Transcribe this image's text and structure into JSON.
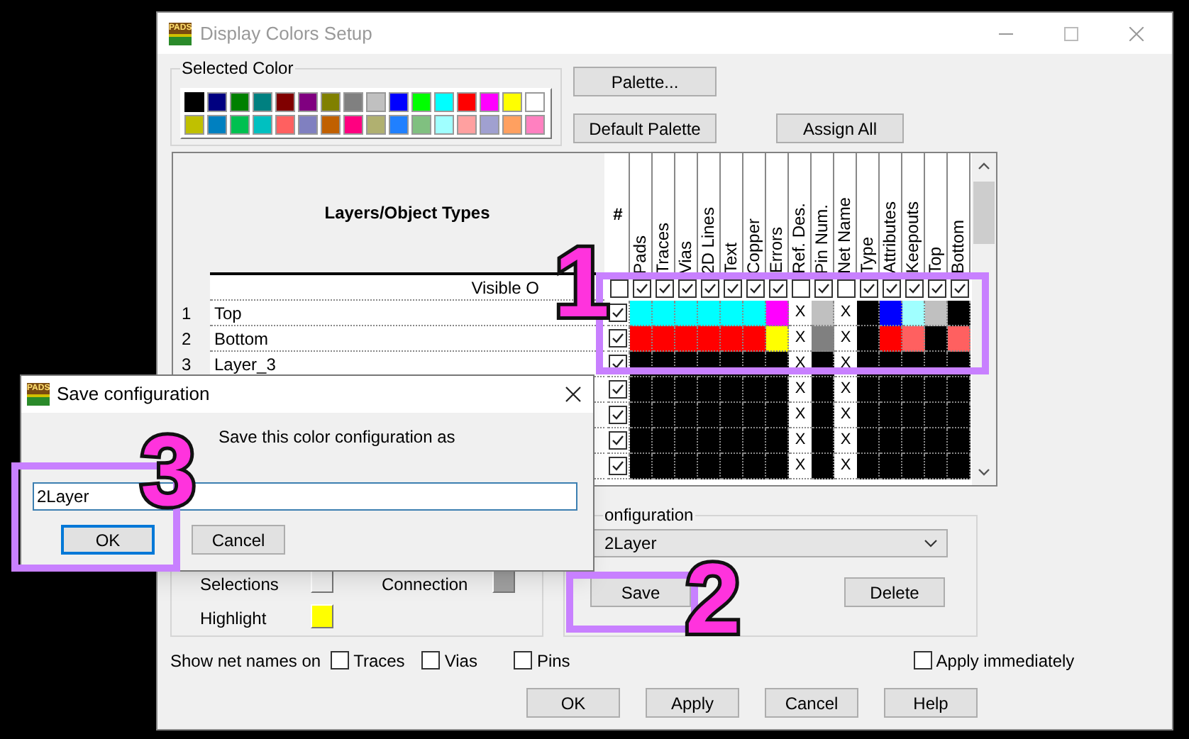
{
  "main_window": {
    "icon_label": "PADS",
    "title": "Display Colors Setup"
  },
  "selected_color": {
    "label": "Selected Color",
    "swatches": [
      {
        "color": "#000000",
        "selected": true
      },
      {
        "color": "#000080",
        "selected": false
      },
      {
        "color": "#008000",
        "selected": false
      },
      {
        "color": "#008080",
        "selected": false
      },
      {
        "color": "#800000",
        "selected": false
      },
      {
        "color": "#800080",
        "selected": false
      },
      {
        "color": "#808000",
        "selected": false
      },
      {
        "color": "#808080",
        "selected": false
      },
      {
        "color": "#c0c0c0",
        "selected": false
      },
      {
        "color": "#0000ff",
        "selected": false
      },
      {
        "color": "#00ff00",
        "selected": false
      },
      {
        "color": "#00ffff",
        "selected": false
      },
      {
        "color": "#ff0000",
        "selected": false
      },
      {
        "color": "#ff00ff",
        "selected": false
      },
      {
        "color": "#ffff00",
        "selected": false
      },
      {
        "color": "#ffffff",
        "selected": false
      },
      {
        "color": "#c0c000",
        "selected": false
      },
      {
        "color": "#0080c0",
        "selected": false
      },
      {
        "color": "#00c050",
        "selected": false
      },
      {
        "color": "#00c0c0",
        "selected": false
      },
      {
        "color": "#ff6060",
        "selected": false
      },
      {
        "color": "#8080c0",
        "selected": false
      },
      {
        "color": "#c06000",
        "selected": false
      },
      {
        "color": "#ff0080",
        "selected": false
      },
      {
        "color": "#b0b070",
        "selected": false
      },
      {
        "color": "#2080ff",
        "selected": false
      },
      {
        "color": "#80c080",
        "selected": false
      },
      {
        "color": "#a0ffff",
        "selected": false
      },
      {
        "color": "#ffa0a0",
        "selected": false
      },
      {
        "color": "#a0a0d0",
        "selected": false
      },
      {
        "color": "#ffa060",
        "selected": false
      },
      {
        "color": "#ff80c0",
        "selected": false
      }
    ]
  },
  "palette_buttons": [
    "Palette...",
    "Default Palette",
    "Assign All"
  ],
  "grid": {
    "title": "Layers/Object Types",
    "visible_label": "Visible O",
    "hash_header": "#",
    "hash_visible": false,
    "columns": [
      {
        "label": "Pads",
        "visible": true
      },
      {
        "label": "Traces",
        "visible": true
      },
      {
        "label": "Vias",
        "visible": true
      },
      {
        "label": "2D Lines",
        "visible": true
      },
      {
        "label": "Text",
        "visible": true
      },
      {
        "label": "Copper",
        "visible": true
      },
      {
        "label": "Errors",
        "visible": true
      },
      {
        "label": "Ref. Des.",
        "visible": false
      },
      {
        "label": "Pin Num.",
        "visible": true
      },
      {
        "label": "Net Name",
        "visible": false
      },
      {
        "label": "Type",
        "visible": true
      },
      {
        "label": "Attributes",
        "visible": true
      },
      {
        "label": "Keepouts",
        "visible": true
      },
      {
        "label": "Top",
        "visible": true
      },
      {
        "label": "Bottom",
        "visible": true
      }
    ],
    "rows": [
      {
        "number": "1",
        "name": "Top",
        "shown": true,
        "cells": [
          {
            "kind": "color",
            "color": "#00ffff"
          },
          {
            "kind": "color",
            "color": "#00ffff"
          },
          {
            "kind": "color",
            "color": "#00ffff"
          },
          {
            "kind": "color",
            "color": "#00ffff"
          },
          {
            "kind": "color",
            "color": "#00ffff"
          },
          {
            "kind": "color",
            "color": "#00ffff"
          },
          {
            "kind": "color",
            "color": "#ff00ff"
          },
          {
            "kind": "mark",
            "text": "X"
          },
          {
            "kind": "color",
            "color": "#c0c0c0"
          },
          {
            "kind": "mark",
            "text": "X"
          },
          {
            "kind": "color",
            "color": "#000000"
          },
          {
            "kind": "color",
            "color": "#0000ff"
          },
          {
            "kind": "color",
            "color": "#a0ffff"
          },
          {
            "kind": "color",
            "color": "#c0c0c0"
          },
          {
            "kind": "color",
            "color": "#000000"
          }
        ]
      },
      {
        "number": "2",
        "name": "Bottom",
        "shown": true,
        "cells": [
          {
            "kind": "color",
            "color": "#ff0000"
          },
          {
            "kind": "color",
            "color": "#ff0000"
          },
          {
            "kind": "color",
            "color": "#ff0000"
          },
          {
            "kind": "color",
            "color": "#ff0000"
          },
          {
            "kind": "color",
            "color": "#ff0000"
          },
          {
            "kind": "color",
            "color": "#ff0000"
          },
          {
            "kind": "color",
            "color": "#ffff00"
          },
          {
            "kind": "mark",
            "text": "X"
          },
          {
            "kind": "color",
            "color": "#808080"
          },
          {
            "kind": "mark",
            "text": "X"
          },
          {
            "kind": "color",
            "color": "#000000"
          },
          {
            "kind": "color",
            "color": "#ff0000"
          },
          {
            "kind": "color",
            "color": "#ff6060"
          },
          {
            "kind": "color",
            "color": "#000000"
          },
          {
            "kind": "color",
            "color": "#ff6060"
          }
        ]
      },
      {
        "number": "3",
        "name": "Layer_3",
        "shown": true,
        "cells": [
          {
            "kind": "color",
            "color": "#000000"
          },
          {
            "kind": "color",
            "color": "#000000"
          },
          {
            "kind": "color",
            "color": "#000000"
          },
          {
            "kind": "color",
            "color": "#000000"
          },
          {
            "kind": "color",
            "color": "#000000"
          },
          {
            "kind": "color",
            "color": "#000000"
          },
          {
            "kind": "color",
            "color": "#000000"
          },
          {
            "kind": "mark",
            "text": "X"
          },
          {
            "kind": "color",
            "color": "#000000"
          },
          {
            "kind": "mark",
            "text": "X"
          },
          {
            "kind": "color",
            "color": "#000000"
          },
          {
            "kind": "color",
            "color": "#000000"
          },
          {
            "kind": "color",
            "color": "#000000"
          },
          {
            "kind": "color",
            "color": "#000000"
          },
          {
            "kind": "color",
            "color": "#000000"
          }
        ]
      },
      {
        "shown": true,
        "cells": [
          {
            "kind": "color",
            "color": "#000000"
          },
          {
            "kind": "color",
            "color": "#000000"
          },
          {
            "kind": "color",
            "color": "#000000"
          },
          {
            "kind": "color",
            "color": "#000000"
          },
          {
            "kind": "color",
            "color": "#000000"
          },
          {
            "kind": "color",
            "color": "#000000"
          },
          {
            "kind": "color",
            "color": "#000000"
          },
          {
            "kind": "mark",
            "text": "X"
          },
          {
            "kind": "color",
            "color": "#000000"
          },
          {
            "kind": "mark",
            "text": "X"
          },
          {
            "kind": "color",
            "color": "#000000"
          },
          {
            "kind": "color",
            "color": "#000000"
          },
          {
            "kind": "color",
            "color": "#000000"
          },
          {
            "kind": "color",
            "color": "#000000"
          },
          {
            "kind": "color",
            "color": "#000000"
          }
        ]
      },
      {
        "shown": true,
        "cells": [
          {
            "kind": "color",
            "color": "#000000"
          },
          {
            "kind": "color",
            "color": "#000000"
          },
          {
            "kind": "color",
            "color": "#000000"
          },
          {
            "kind": "color",
            "color": "#000000"
          },
          {
            "kind": "color",
            "color": "#000000"
          },
          {
            "kind": "color",
            "color": "#000000"
          },
          {
            "kind": "color",
            "color": "#000000"
          },
          {
            "kind": "mark",
            "text": "X"
          },
          {
            "kind": "color",
            "color": "#000000"
          },
          {
            "kind": "mark",
            "text": "X"
          },
          {
            "kind": "color",
            "color": "#000000"
          },
          {
            "kind": "color",
            "color": "#000000"
          },
          {
            "kind": "color",
            "color": "#000000"
          },
          {
            "kind": "color",
            "color": "#000000"
          },
          {
            "kind": "color",
            "color": "#000000"
          }
        ]
      },
      {
        "shown": true,
        "cells": [
          {
            "kind": "color",
            "color": "#000000"
          },
          {
            "kind": "color",
            "color": "#000000"
          },
          {
            "kind": "color",
            "color": "#000000"
          },
          {
            "kind": "color",
            "color": "#000000"
          },
          {
            "kind": "color",
            "color": "#000000"
          },
          {
            "kind": "color",
            "color": "#000000"
          },
          {
            "kind": "color",
            "color": "#000000"
          },
          {
            "kind": "mark",
            "text": "X"
          },
          {
            "kind": "color",
            "color": "#000000"
          },
          {
            "kind": "mark",
            "text": "X"
          },
          {
            "kind": "color",
            "color": "#000000"
          },
          {
            "kind": "color",
            "color": "#000000"
          },
          {
            "kind": "color",
            "color": "#000000"
          },
          {
            "kind": "color",
            "color": "#000000"
          },
          {
            "kind": "color",
            "color": "#000000"
          }
        ]
      },
      {
        "shown": true,
        "cells": [
          {
            "kind": "color",
            "color": "#000000"
          },
          {
            "kind": "color",
            "color": "#000000"
          },
          {
            "kind": "color",
            "color": "#000000"
          },
          {
            "kind": "color",
            "color": "#000000"
          },
          {
            "kind": "color",
            "color": "#000000"
          },
          {
            "kind": "color",
            "color": "#000000"
          },
          {
            "kind": "color",
            "color": "#000000"
          },
          {
            "kind": "mark",
            "text": "X"
          },
          {
            "kind": "color",
            "color": "#000000"
          },
          {
            "kind": "mark",
            "text": "X"
          },
          {
            "kind": "color",
            "color": "#000000"
          },
          {
            "kind": "color",
            "color": "#000000"
          },
          {
            "kind": "color",
            "color": "#000000"
          },
          {
            "kind": "color",
            "color": "#000000"
          },
          {
            "kind": "color",
            "color": "#000000"
          }
        ]
      }
    ]
  },
  "object_colors": [
    {
      "label": "Selections",
      "color": "#eeeeee"
    },
    {
      "label": "Connection",
      "color": "#a0a0a0"
    },
    {
      "label": "Highlight",
      "color": "#ffff00"
    }
  ],
  "configuration": {
    "label": "onfiguration",
    "value": "2Layer",
    "buttons": [
      "Save",
      "Delete"
    ]
  },
  "show_net_names": {
    "label": "Show net names on",
    "options": [
      {
        "label": "Traces",
        "checked": false
      },
      {
        "label": "Vias",
        "checked": false
      },
      {
        "label": "Pins",
        "checked": false
      }
    ]
  },
  "apply_immediately": {
    "label": "Apply immediately",
    "checked": false
  },
  "bottom_buttons": [
    "OK",
    "Apply",
    "Cancel",
    "Help"
  ],
  "save_dialog": {
    "icon_label": "PADS",
    "title": "Save configuration",
    "prompt": "Save this color configuration as",
    "value": "2Layer",
    "buttons": [
      {
        "label": "OK",
        "focused": true
      },
      {
        "label": "Cancel",
        "focused": false
      }
    ]
  },
  "annotations": [
    {
      "number": "1"
    },
    {
      "number": "2"
    },
    {
      "number": "3"
    }
  ]
}
